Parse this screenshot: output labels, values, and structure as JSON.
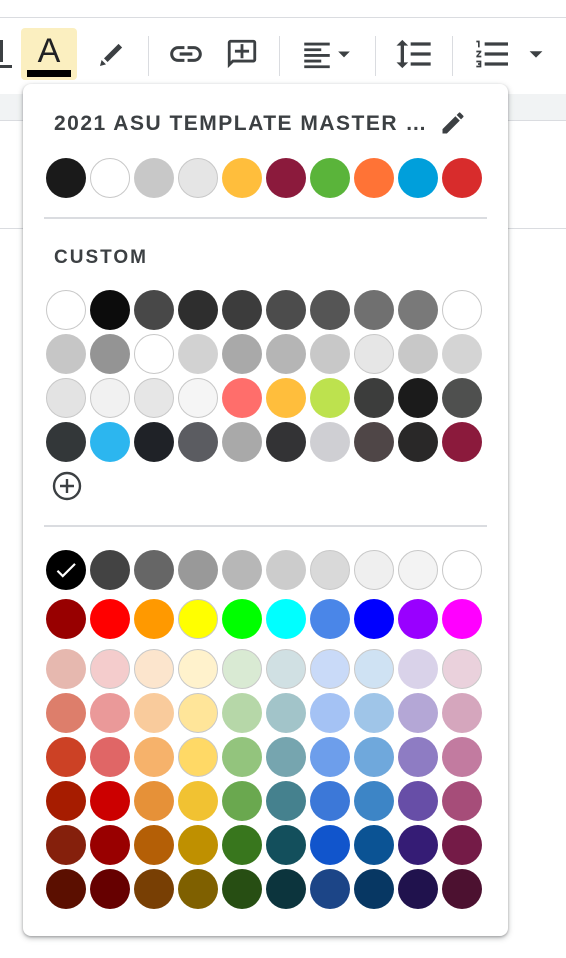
{
  "toolbar": {
    "text_color_glyph": "A",
    "text_color_bar": "#000000"
  },
  "theme": {
    "title": "2021 ASU TEMPLATE MASTER …",
    "colors": [
      "#1a1a1a",
      "#ffffff",
      "#c8c8c8",
      "#e5e5e5",
      "#ffbe3c",
      "#8b1a3c",
      "#5ab43a",
      "#ff7336",
      "#009fdb",
      "#d82c2c"
    ]
  },
  "custom": {
    "title": "CUSTOM",
    "rows": [
      [
        "#ffffff",
        "#0c0c0c",
        "#484848",
        "#2e2e2e",
        "#3c3c3c",
        "#4c4c4c",
        "#555555",
        "#707070",
        "#797979",
        "#ffffff"
      ],
      [
        "#c6c6c6",
        "#949494",
        "#ffffff",
        "#d2d2d2",
        "#a9a9a9",
        "#b5b5b5",
        "#c8c8c8",
        "#e6e6e6",
        "#c8c8c8",
        "#d4d4d4"
      ],
      [
        "#e3e3e3",
        "#f1f1f1",
        "#e6e6e6",
        "#f5f5f5",
        "#ff6e6b",
        "#ffbe3c",
        "#bde24e",
        "#3c3d3c",
        "#1b1b1b",
        "#4f504f"
      ],
      [
        "#333739",
        "#2cb6ef",
        "#1f2227",
        "#5b5c61",
        "#a9a9a9",
        "#333335",
        "#cfcfd3",
        "#4f4647",
        "#292828",
        "#8b1a3c"
      ]
    ]
  },
  "standard": {
    "selected": "#000000",
    "rows": [
      [
        "#000000",
        "#434343",
        "#666666",
        "#999999",
        "#b7b7b7",
        "#cccccc",
        "#d9d9d9",
        "#efefef",
        "#f3f3f3",
        "#ffffff"
      ],
      [
        "#980000",
        "#ff0000",
        "#ff9900",
        "#ffff00",
        "#00ff00",
        "#00ffff",
        "#4a86e8",
        "#0000ff",
        "#9900ff",
        "#ff00ff"
      ],
      [
        "#e6b8af",
        "#f4cccc",
        "#fce5cd",
        "#fff2cc",
        "#d9ead3",
        "#d0e0e3",
        "#c9daf8",
        "#cfe2f3",
        "#d9d2e9",
        "#ead1dc"
      ],
      [
        "#dd7e6b",
        "#ea9999",
        "#f9cb9c",
        "#ffe599",
        "#b6d7a8",
        "#a2c4c9",
        "#a4c2f4",
        "#9fc5e8",
        "#b4a7d6",
        "#d5a6bd"
      ],
      [
        "#cc4125",
        "#e06666",
        "#f6b26b",
        "#ffd966",
        "#93c47d",
        "#76a5af",
        "#6d9eeb",
        "#6fa8dc",
        "#8e7cc3",
        "#c27ba0"
      ],
      [
        "#a61c00",
        "#cc0000",
        "#e69138",
        "#f1c232",
        "#6aa84f",
        "#45818e",
        "#3c78d8",
        "#3d85c6",
        "#674ea7",
        "#a64d79"
      ],
      [
        "#85200c",
        "#990000",
        "#b45f06",
        "#bf9000",
        "#38761d",
        "#134f5c",
        "#1155cc",
        "#0b5394",
        "#351c75",
        "#741b47"
      ],
      [
        "#5b0f00",
        "#660000",
        "#783f04",
        "#7f6000",
        "#274e13",
        "#0c343d",
        "#1c4587",
        "#073763",
        "#20124d",
        "#4c1130"
      ]
    ]
  }
}
